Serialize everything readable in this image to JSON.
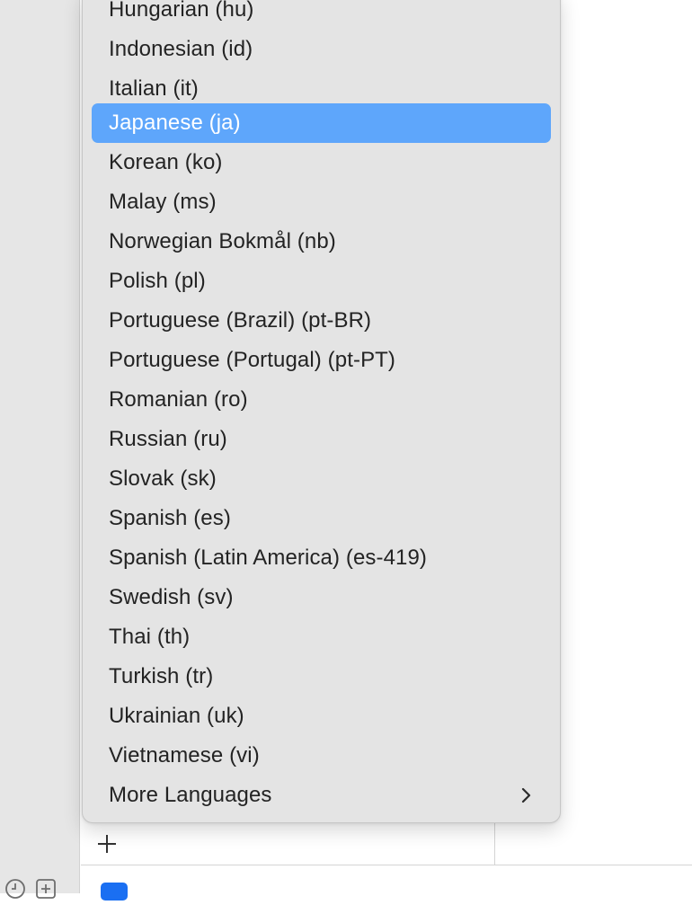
{
  "language_menu": {
    "items": [
      {
        "label": "Hungarian (hu)"
      },
      {
        "label": "Indonesian (id)"
      },
      {
        "label": "Italian (it)"
      },
      {
        "label": "Japanese (ja)",
        "selected": true
      },
      {
        "label": "Korean (ko)"
      },
      {
        "label": "Malay (ms)"
      },
      {
        "label": "Norwegian Bokmål (nb)"
      },
      {
        "label": "Polish (pl)"
      },
      {
        "label": "Portuguese (Brazil) (pt-BR)"
      },
      {
        "label": "Portuguese (Portugal) (pt-PT)"
      },
      {
        "label": "Romanian (ro)"
      },
      {
        "label": "Russian (ru)"
      },
      {
        "label": "Slovak (sk)"
      },
      {
        "label": "Spanish (es)"
      },
      {
        "label": "Spanish (Latin America) (es-419)"
      },
      {
        "label": "Swedish (sv)"
      },
      {
        "label": "Thai (th)"
      },
      {
        "label": "Turkish (tr)"
      },
      {
        "label": "Ukrainian (uk)"
      },
      {
        "label": "Vietnamese (vi)"
      }
    ],
    "more_languages": {
      "label": "More Languages",
      "icon": "chevron-right-icon"
    }
  },
  "toolbar": {
    "add_icon": "plus-icon"
  },
  "sidebar": {
    "icons": [
      "clock-icon",
      "add-square-icon"
    ]
  },
  "colors": {
    "highlight": "#5ea6fb",
    "menu_background": "#e4e4e4",
    "accent_blue": "#1a6ff2"
  }
}
